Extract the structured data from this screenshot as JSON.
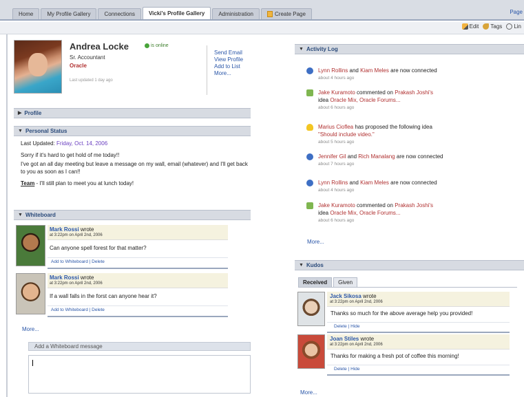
{
  "tabs": [
    {
      "label": "Home"
    },
    {
      "label": "My Profile Gallery"
    },
    {
      "label": "Connections"
    },
    {
      "label": "Vicki's Profile Gallery"
    },
    {
      "label": "Administration"
    },
    {
      "label": "Create Page"
    }
  ],
  "pages_link": "Page",
  "actions": {
    "edit": "Edit",
    "tags": "Tags",
    "link": "Lin"
  },
  "profile": {
    "name": "Andrea Locke",
    "status": "is online",
    "title": "Sr. Accountant",
    "company": "Oracle",
    "last_updated": "Last updated 1 day ago",
    "links": [
      "Send Email",
      "View Profile",
      "Add to List",
      "More..."
    ]
  },
  "sections": {
    "profile": "Profile",
    "personal_status": "Personal Status",
    "whiteboard": "Whiteboard",
    "activity_log": "Activity Log",
    "kudos": "Kudos"
  },
  "personal_status": {
    "last_updated_label": "Last Updated:",
    "last_updated_date": "Friday, Oct. 14, 2006",
    "line1": "Sorry if it's hard to get hold of me today!!",
    "line2": "I've got an all day meeting but leave a message on my wall, email (whatever) and I'll get back to you as soon as I can!!",
    "team_label": "Team",
    "team_text": " - I'll still plan to meet you at lunch today!"
  },
  "whiteboard": {
    "entries": [
      {
        "author": "Mark Rossi",
        "verb": " wrote",
        "time": "at 3:22pm on April 2nd, 2006",
        "message": "Can anyone spell forest for that matter?",
        "footer": "Add to Whiteboard | Delete"
      },
      {
        "author": "Mark Rossi",
        "verb": " wrote",
        "time": "at 3:22pm on April 2nd, 2006",
        "message": "If a wall falls in the forst can anyone hear it?",
        "footer": "Add to Whiteboard | Delete"
      }
    ],
    "more": "More...",
    "add_message": "Add a Whiteboard message"
  },
  "activity": [
    {
      "type": "info",
      "parts": [
        [
          "Lynn Rollins",
          "red"
        ],
        [
          " and ",
          ""
        ],
        [
          "Kiam Meles",
          "red"
        ],
        [
          " are now connected",
          ""
        ]
      ],
      "ago": "about 4 hours ago"
    },
    {
      "type": "comment",
      "parts": [
        [
          "Jake Kuramoto",
          "red"
        ],
        [
          " commented on ",
          ""
        ],
        [
          "Prakash Joshi's",
          "red"
        ],
        [
          " idea ",
          ""
        ],
        [
          "Oracle Mix, Oracle Forums...",
          "red"
        ]
      ],
      "ago": "about 6 hours ago"
    },
    {
      "type": "idea",
      "parts": [
        [
          "Marius Cioflea",
          "red"
        ],
        [
          " has proposed the following idea ",
          ""
        ],
        [
          "\"Should include video.\"",
          "red"
        ]
      ],
      "ago": "about 5 hours ago"
    },
    {
      "type": "info",
      "parts": [
        [
          "Jennifer Gil",
          "red"
        ],
        [
          " and ",
          ""
        ],
        [
          "Rich Manalang",
          "red"
        ],
        [
          " are now connected",
          ""
        ]
      ],
      "ago": "about 7 hours ago"
    },
    {
      "type": "info",
      "parts": [
        [
          "Lynn Rollins",
          "red"
        ],
        [
          " and ",
          ""
        ],
        [
          "Kiam Meles",
          "red"
        ],
        [
          " are now connected",
          ""
        ]
      ],
      "ago": "about 4 hours ago"
    },
    {
      "type": "comment",
      "parts": [
        [
          "Jake Kuramoto",
          "red"
        ],
        [
          " commented on ",
          ""
        ],
        [
          "Prakash Joshi's",
          "red"
        ],
        [
          " idea ",
          ""
        ],
        [
          "Oracle Mix, Oracle Forums...",
          "red"
        ]
      ],
      "ago": "about 6 hours ago"
    }
  ],
  "activity_more": "More...",
  "kudos": {
    "tabs": [
      "Received",
      "Given"
    ],
    "entries": [
      {
        "author": "Jack Sikosa",
        "verb": " wrote",
        "time": "at 3:22pm on April 2nd, 2006",
        "message": "Thanks so much for the above average help you provided!",
        "footer": "Delete | Hide"
      },
      {
        "author": "Joan Stiles",
        "verb": " wrote",
        "time": "at 3:22pm on April 2nd, 2006",
        "message": "Thanks for making a fresh pot of coffee this morning!",
        "footer": "Delete | Hide"
      }
    ],
    "more": "More..."
  }
}
